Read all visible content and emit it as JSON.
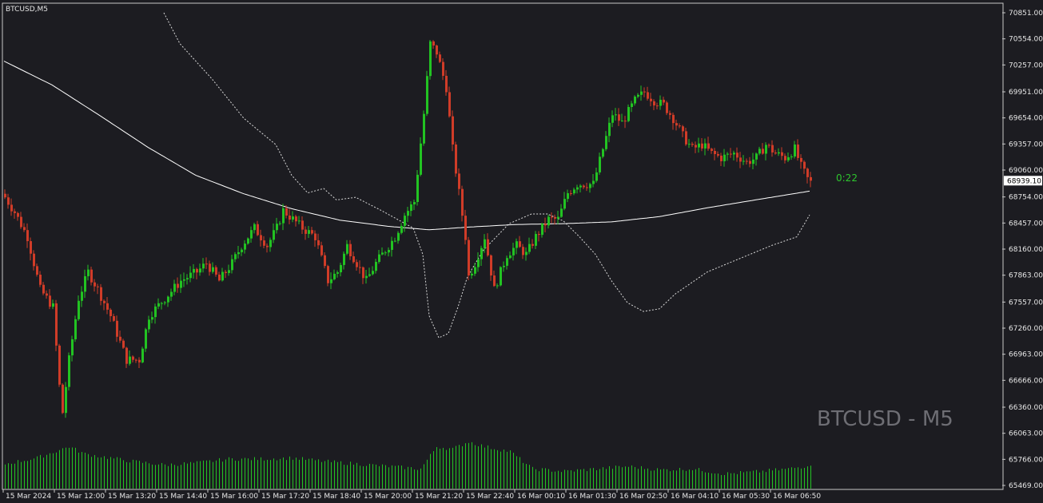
{
  "window": {
    "title": "BTCUSD,M5"
  },
  "watermark": "BTCUSD - M5",
  "timer": "0:22",
  "current_price": "68939.10",
  "colors": {
    "background": "#1c1c21",
    "bull": "#22c322",
    "bear": "#d03c28",
    "volume": "#24c224",
    "moving_average": "#ffffff",
    "envelope": "#d9d9d9",
    "text": "#e6e6e6",
    "watermark": "#6e6e74",
    "timer": "#2ec52e"
  },
  "chart_data": {
    "type": "candlestick",
    "symbol": "BTCUSD",
    "timeframe": "M5",
    "y_ticks": [
      "70851.00",
      "70554.00",
      "70257.00",
      "69951.00",
      "69654.00",
      "69357.00",
      "69060.00",
      "68754.00",
      "68457.00",
      "68160.00",
      "67863.00",
      "67557.00",
      "67260.00",
      "66963.00",
      "66666.00",
      "66360.00",
      "66063.00",
      "65766.00",
      "65469.00"
    ],
    "ylim": [
      65469,
      70851
    ],
    "x_ticks": [
      "15 Mar 2024",
      "15 Mar 12:00",
      "15 Mar 13:20",
      "15 Mar 14:40",
      "15 Mar 16:00",
      "15 Mar 17:20",
      "15 Mar 18:40",
      "15 Mar 20:00",
      "15 Mar 21:20",
      "15 Mar 22:40",
      "16 Mar 00:10",
      "16 Mar 01:30",
      "16 Mar 02:50",
      "16 Mar 04:10",
      "16 Mar 05:30",
      "16 Mar 06:50"
    ],
    "close_anchors": [
      [
        0,
        68750
      ],
      [
        3,
        68580
      ],
      [
        7,
        68300
      ],
      [
        11,
        67700
      ],
      [
        15,
        67500
      ],
      [
        17,
        66600
      ],
      [
        18,
        66300
      ],
      [
        20,
        66900
      ],
      [
        23,
        67600
      ],
      [
        26,
        67900
      ],
      [
        29,
        67700
      ],
      [
        33,
        67400
      ],
      [
        38,
        66900
      ],
      [
        42,
        66900
      ],
      [
        45,
        67400
      ],
      [
        50,
        67600
      ],
      [
        55,
        67800
      ],
      [
        60,
        67900
      ],
      [
        63,
        68000
      ],
      [
        67,
        67800
      ],
      [
        71,
        68000
      ],
      [
        74,
        68200
      ],
      [
        78,
        68400
      ],
      [
        82,
        68200
      ],
      [
        85,
        68400
      ],
      [
        87,
        68600
      ],
      [
        90,
        68500
      ],
      [
        93,
        68400
      ],
      [
        97,
        68300
      ],
      [
        101,
        67800
      ],
      [
        104,
        67900
      ],
      [
        107,
        68200
      ],
      [
        110,
        68000
      ],
      [
        113,
        67800
      ],
      [
        116,
        68000
      ],
      [
        119,
        68150
      ],
      [
        122,
        68300
      ],
      [
        125,
        68550
      ],
      [
        128,
        68700
      ],
      [
        131,
        69700
      ],
      [
        133,
        70500
      ],
      [
        135,
        70400
      ],
      [
        138,
        70000
      ],
      [
        140,
        69300
      ],
      [
        142,
        68800
      ],
      [
        144,
        68300
      ],
      [
        145,
        67850
      ],
      [
        147,
        68000
      ],
      [
        150,
        68300
      ],
      [
        153,
        67700
      ],
      [
        157,
        68100
      ],
      [
        160,
        68200
      ],
      [
        163,
        68100
      ],
      [
        166,
        68300
      ],
      [
        170,
        68500
      ],
      [
        173,
        68500
      ],
      [
        176,
        68800
      ],
      [
        179,
        68900
      ],
      [
        181,
        68900
      ],
      [
        184,
        68900
      ],
      [
        187,
        69300
      ],
      [
        190,
        69700
      ],
      [
        193,
        69600
      ],
      [
        197,
        69850
      ],
      [
        200,
        69950
      ],
      [
        203,
        69850
      ],
      [
        206,
        69800
      ],
      [
        209,
        69650
      ],
      [
        212,
        69450
      ],
      [
        215,
        69300
      ],
      [
        218,
        69350
      ],
      [
        221,
        69250
      ],
      [
        224,
        69200
      ],
      [
        228,
        69250
      ],
      [
        232,
        69150
      ],
      [
        235,
        69200
      ],
      [
        238,
        69350
      ],
      [
        241,
        69250
      ],
      [
        244,
        69200
      ],
      [
        247,
        69300
      ],
      [
        249,
        69100
      ],
      [
        251,
        68960
      ],
      [
        252,
        68939
      ]
    ],
    "ma_anchors": [
      [
        0,
        70300
      ],
      [
        15,
        70030
      ],
      [
        30,
        69680
      ],
      [
        45,
        69320
      ],
      [
        60,
        69000
      ],
      [
        75,
        68790
      ],
      [
        90,
        68620
      ],
      [
        105,
        68490
      ],
      [
        120,
        68420
      ],
      [
        133,
        68380
      ],
      [
        145,
        68410
      ],
      [
        160,
        68440
      ],
      [
        175,
        68450
      ],
      [
        190,
        68470
      ],
      [
        205,
        68530
      ],
      [
        220,
        68630
      ],
      [
        235,
        68720
      ],
      [
        252,
        68820
      ]
    ],
    "env_upper_anchors": [
      [
        50,
        70851
      ],
      [
        55,
        70500
      ],
      [
        65,
        70100
      ],
      [
        75,
        69650
      ],
      [
        85,
        69350
      ],
      [
        90,
        69000
      ],
      [
        95,
        68800
      ],
      [
        100,
        68850
      ],
      [
        104,
        68720
      ],
      [
        110,
        68750
      ],
      [
        118,
        68600
      ],
      [
        128,
        68400
      ],
      [
        131,
        68100
      ],
      [
        133,
        67400
      ],
      [
        136,
        67150
      ],
      [
        139,
        67200
      ],
      [
        142,
        67500
      ],
      [
        145,
        67850
      ],
      [
        150,
        68150
      ],
      [
        158,
        68450
      ],
      [
        165,
        68560
      ],
      [
        170,
        68560
      ],
      [
        175,
        68480
      ],
      [
        180,
        68300
      ],
      [
        185,
        68100
      ],
      [
        190,
        67800
      ],
      [
        195,
        67550
      ],
      [
        200,
        67450
      ],
      [
        205,
        67480
      ],
      [
        210,
        67650
      ],
      [
        220,
        67900
      ],
      [
        230,
        68050
      ],
      [
        240,
        68200
      ],
      [
        248,
        68300
      ],
      [
        252,
        68550
      ]
    ],
    "volume_anchors": [
      [
        0,
        0.5
      ],
      [
        10,
        0.62
      ],
      [
        20,
        0.85
      ],
      [
        25,
        0.7
      ],
      [
        40,
        0.55
      ],
      [
        50,
        0.48
      ],
      [
        60,
        0.52
      ],
      [
        70,
        0.6
      ],
      [
        80,
        0.6
      ],
      [
        90,
        0.62
      ],
      [
        100,
        0.55
      ],
      [
        110,
        0.5
      ],
      [
        120,
        0.45
      ],
      [
        130,
        0.4
      ],
      [
        135,
        0.85
      ],
      [
        140,
        0.8
      ],
      [
        145,
        0.95
      ],
      [
        150,
        0.85
      ],
      [
        158,
        0.75
      ],
      [
        165,
        0.4
      ],
      [
        175,
        0.35
      ],
      [
        185,
        0.4
      ],
      [
        195,
        0.45
      ],
      [
        205,
        0.38
      ],
      [
        215,
        0.4
      ],
      [
        225,
        0.3
      ],
      [
        235,
        0.34
      ],
      [
        245,
        0.4
      ],
      [
        250,
        0.45
      ],
      [
        252,
        0.5
      ]
    ]
  }
}
